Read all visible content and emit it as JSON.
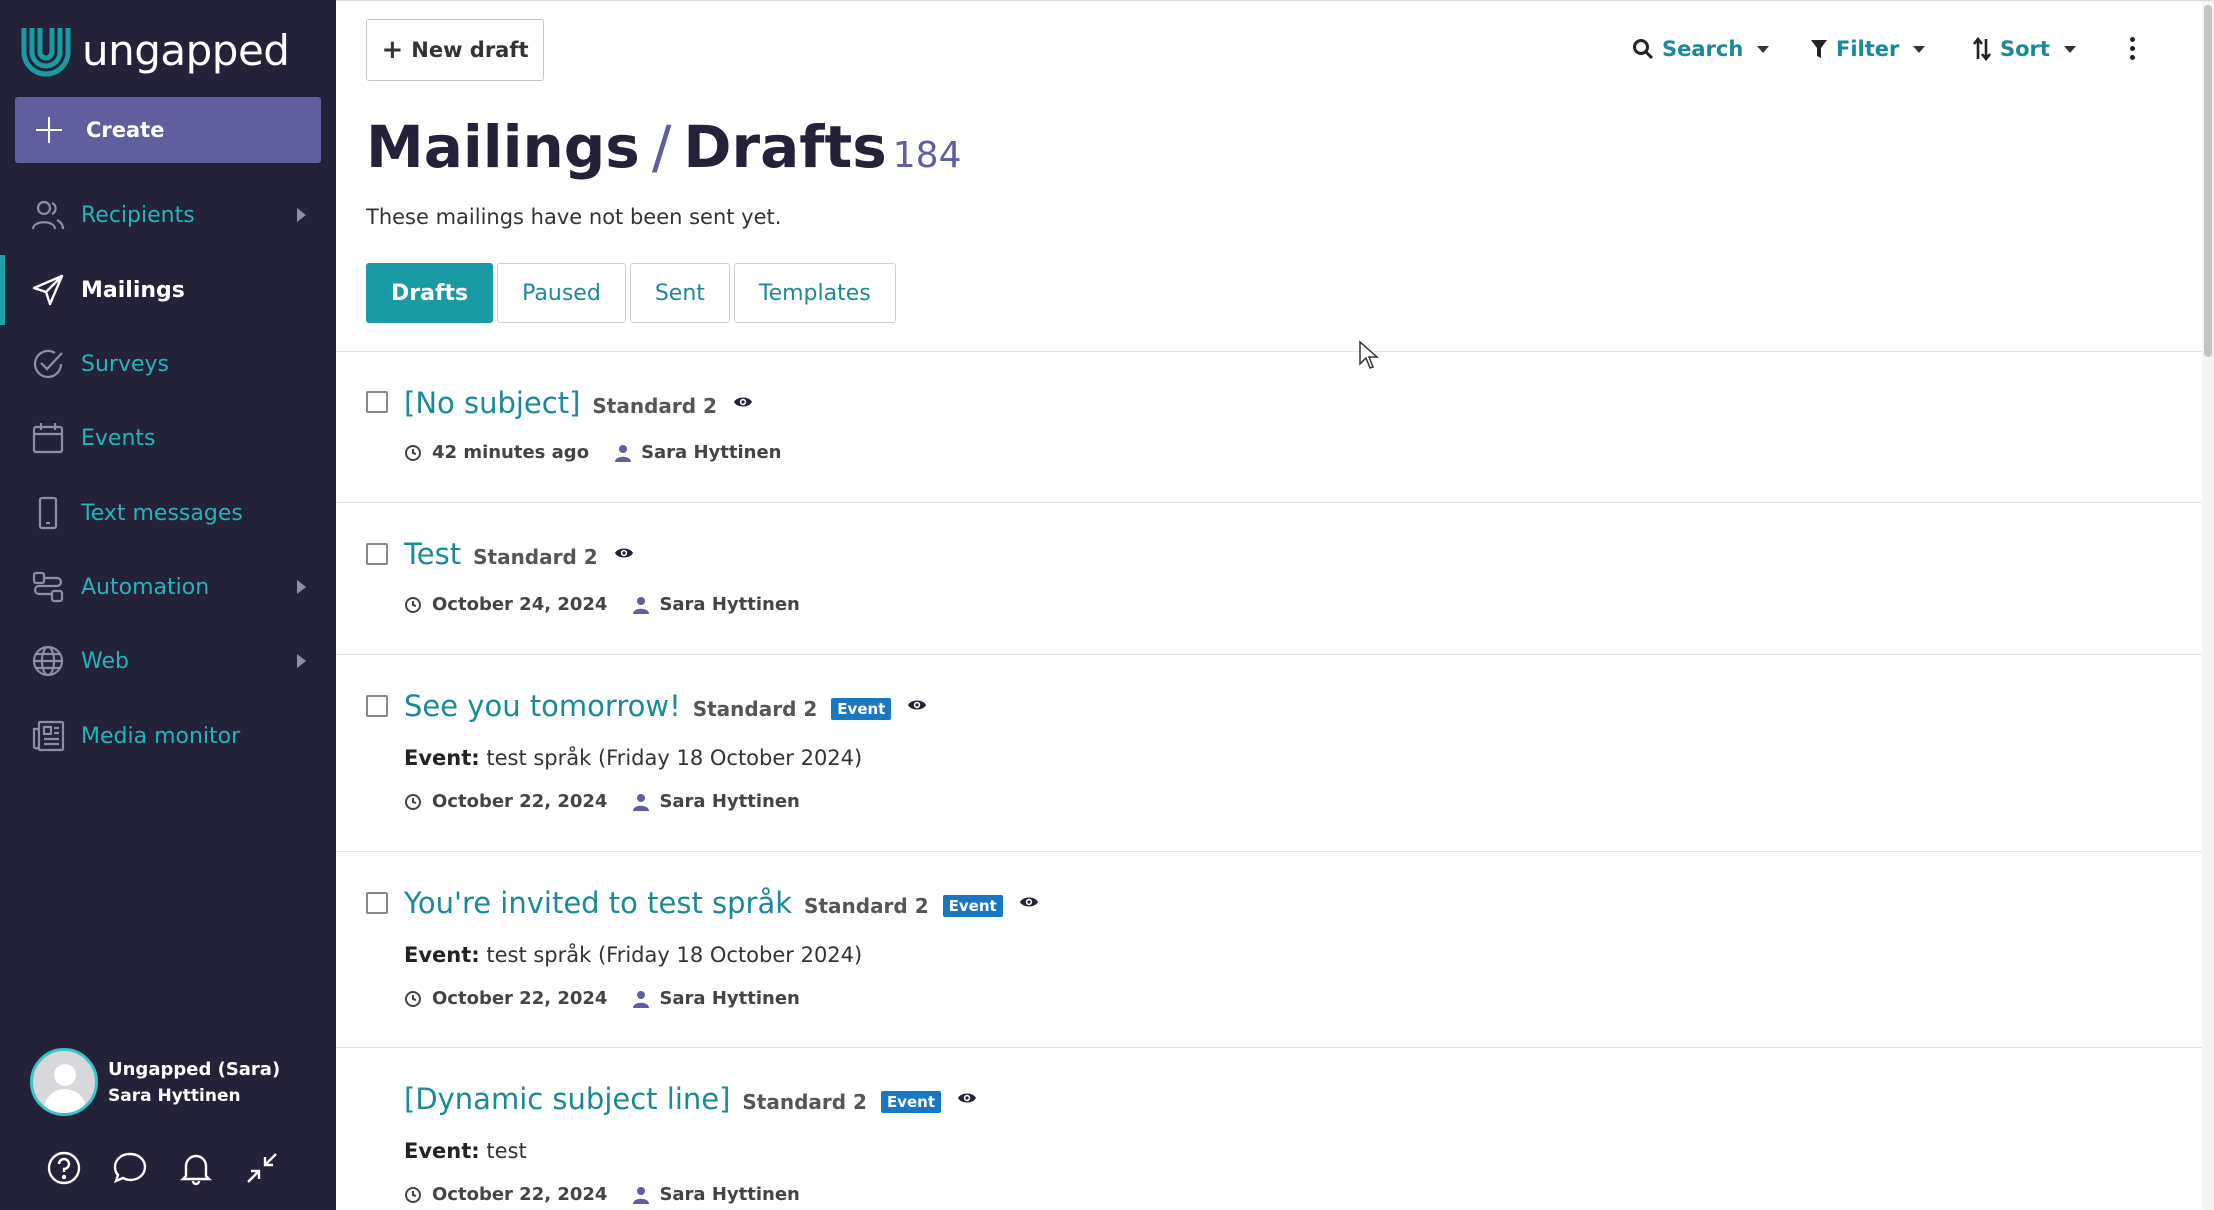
{
  "brand": {
    "name": "ungapped"
  },
  "sidebar": {
    "create_label": "Create",
    "items": [
      {
        "label": "Recipients",
        "icon": "users-icon",
        "has_submenu": true
      },
      {
        "label": "Mailings",
        "icon": "send-icon",
        "active": true
      },
      {
        "label": "Surveys",
        "icon": "check-circle-icon"
      },
      {
        "label": "Events",
        "icon": "calendar-icon"
      },
      {
        "label": "Text messages",
        "icon": "mobile-icon"
      },
      {
        "label": "Automation",
        "icon": "workflow-icon",
        "has_submenu": true
      },
      {
        "label": "Web",
        "icon": "globe-icon",
        "has_submenu": true
      },
      {
        "label": "Media monitor",
        "icon": "newspaper-icon"
      }
    ],
    "user": {
      "org": "Ungapped (Sara)",
      "name": "Sara Hyttinen"
    }
  },
  "toolbar": {
    "new_draft_label": "New draft",
    "search_label": "Search",
    "filter_label": "Filter",
    "sort_label": "Sort"
  },
  "page": {
    "title_section": "Mailings",
    "separator": "/",
    "title_sub": "Drafts",
    "count": "184",
    "subtitle": "These mailings have not been sent yet."
  },
  "tabs": [
    {
      "label": "Drafts",
      "active": true
    },
    {
      "label": "Paused"
    },
    {
      "label": "Sent"
    },
    {
      "label": "Templates"
    }
  ],
  "mailings": [
    {
      "subject": "[No subject]",
      "template": "Standard 2",
      "badge": "",
      "event_label": "",
      "event_text": "",
      "time": "42 minutes ago",
      "author": "Sara Hyttinen",
      "checkbox": true
    },
    {
      "subject": "Test",
      "template": "Standard 2",
      "badge": "",
      "event_label": "",
      "event_text": "",
      "time": "October 24, 2024",
      "author": "Sara Hyttinen",
      "checkbox": true
    },
    {
      "subject": "See you tomorrow!",
      "template": "Standard 2",
      "badge": "Event",
      "event_label": "Event:",
      "event_text": " test språk (Friday 18 October 2024)",
      "time": "October 22, 2024",
      "author": "Sara Hyttinen",
      "checkbox": true
    },
    {
      "subject": "You're invited to test språk",
      "template": "Standard 2",
      "badge": "Event",
      "event_label": "Event:",
      "event_text": " test språk (Friday 18 October 2024)",
      "time": "October 22, 2024",
      "author": "Sara Hyttinen",
      "checkbox": true
    },
    {
      "subject": "[Dynamic subject line]",
      "template": "Standard 2",
      "badge": "Event",
      "event_label": "Event:",
      "event_text": " test",
      "time": "October 22, 2024",
      "author": "Sara Hyttinen",
      "checkbox": false
    }
  ],
  "colors": {
    "sidebar_bg": "#232238",
    "accent": "#1a9aa2",
    "create_bg": "#5f5e9e",
    "badge": "#1a78c2"
  }
}
